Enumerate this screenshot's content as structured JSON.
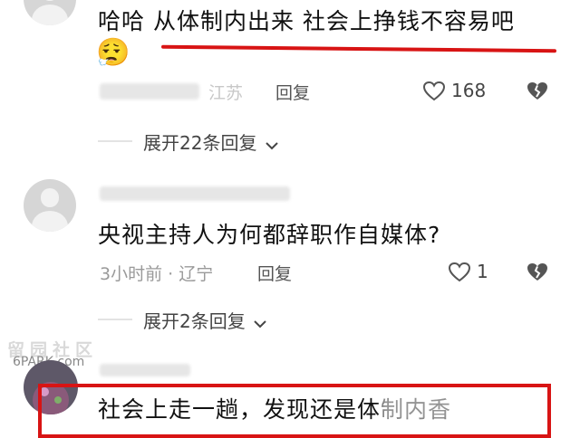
{
  "comments": [
    {
      "text": "哈哈 从体制内出来 社会上挣钱不容易吧",
      "emoji": "😮‍💨",
      "location": "江苏",
      "reply_label": "回复",
      "likes": "168",
      "expand_label": "展开22条回复"
    },
    {
      "text": "央视主持人为何都辞职作自媒体?",
      "time_location": "3小时前 · 辽宁",
      "reply_label": "回复",
      "likes": "1",
      "expand_label": "展开2条回复"
    },
    {
      "text": "社会上走一趟，发现还是体制内香"
    }
  ],
  "watermark": {
    "site_cn": "留园社区",
    "site": "6PARK.com"
  },
  "colors": {
    "highlight": "#d81414",
    "meta": "#9a9a9a"
  },
  "icons": [
    "heart-icon",
    "broken-heart-icon",
    "chevron-down-icon",
    "avatar-icon"
  ]
}
